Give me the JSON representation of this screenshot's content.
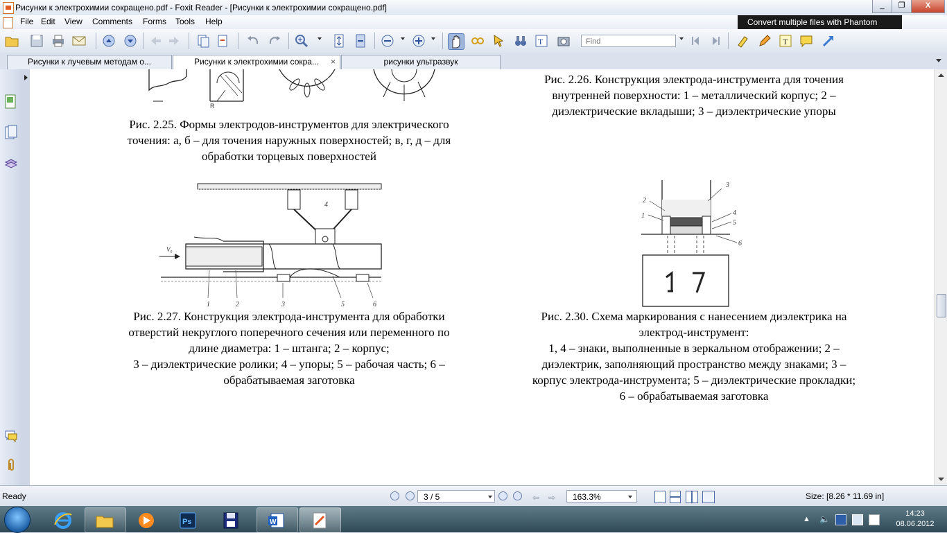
{
  "window": {
    "title": "Рисунки к электрохимии сокращено.pdf - Foxit Reader - [Рисунки к электрохимии сокращено.pdf]",
    "minimize": "_",
    "restore": "❐",
    "close": "X"
  },
  "menu": [
    "File",
    "Edit",
    "View",
    "Comments",
    "Forms",
    "Tools",
    "Help"
  ],
  "toolbar": {
    "find_placeholder": "Find",
    "ad_text": "Convert multiple files with Phantom",
    "icons": [
      "open-icon",
      "save-icon",
      "print-icon",
      "email-icon",
      "prev-page-icon",
      "next-page-icon",
      "back-icon",
      "forward-icon",
      "copy-page-icon",
      "extract-page-icon",
      "undo-icon",
      "redo-icon",
      "zoom-in-icon",
      "fit-page-icon",
      "fit-width-icon",
      "zoom-out-minus-icon",
      "zoom-in-plus-icon",
      "hand-icon",
      "select-text-icon",
      "select-icon",
      "find-binoculars-icon",
      "binoculars-icon",
      "text-tool-icon",
      "snapshot-icon",
      "find-prev-icon",
      "find-next-icon",
      "highlight-icon",
      "pencil-icon",
      "typewriter-icon",
      "note-icon",
      "arrow-icon"
    ]
  },
  "tabs": [
    {
      "label": "Рисунки к лучевым методам о...",
      "active": false
    },
    {
      "label": "Рисунки к электрохимии сокра...",
      "active": true,
      "close": "×"
    },
    {
      "label": "рисунки ультразвук",
      "active": false
    }
  ],
  "document": {
    "fig_2_25": {
      "caption": [
        "Рис. 2.25. Формы электродов-инструментов для электрического",
        "точения: а, б – для точения наружных поверхностей; в, г, д – для",
        "обработки торцевых поверхностей"
      ],
      "label_r": "R"
    },
    "fig_2_26": {
      "caption": [
        "Рис. 2.26. Конструкция электрода-инструмента для точения",
        "внутренней поверхности: 1 – металлический корпус; 2 –",
        "диэлектрические вкладыши; 3 – диэлектрические упоры"
      ]
    },
    "fig_2_27": {
      "caption": [
        "Рис. 2.27. Конструкция электрода-инструмента для обработки",
        "отверстий некруглого поперечного сечения или переменного по",
        "длине диаметра: 1 – штанга; 2 – корпус;",
        "3 – диэлектрические ролики; 4 – упоры; 5 – рабочая часть; 6 –",
        "обрабатываемая заготовка"
      ],
      "labels": {
        "v": "V₀",
        "n1": "1",
        "n2": "2",
        "n3": "3",
        "n4": "4",
        "n5": "5",
        "n6": "6"
      }
    },
    "fig_2_30": {
      "caption": [
        "Рис. 2.30. Схема маркирования с нанесением диэлектрика на",
        "электрод-инструмент:",
        "1, 4 – знаки, выполненные в зеркальном отображении; 2 –",
        "диэлектрик, заполняющий пространство между знаками; 3 –",
        "корпус электрода-инструмента; 5 – диэлектрические прокладки;",
        "6 – обрабатываемая заготовка"
      ],
      "labels": {
        "n1": "1",
        "n2": "2",
        "n3": "3",
        "n4": "4",
        "n5": "5",
        "n6": "6"
      }
    }
  },
  "status": {
    "ready": "Ready",
    "page": "3 / 5",
    "zoom": "163.3%",
    "size": "Size: [8.26 * 11.69 in]"
  },
  "taskbar": {
    "time": "14:23",
    "date": "08.06.2012",
    "apps": [
      "start-orb-icon",
      "internet-explorer-icon",
      "file-explorer-icon",
      "media-player-icon",
      "photoshop-icon",
      "save-floppy-icon",
      "word-icon",
      "foxit-reader-icon"
    ]
  }
}
